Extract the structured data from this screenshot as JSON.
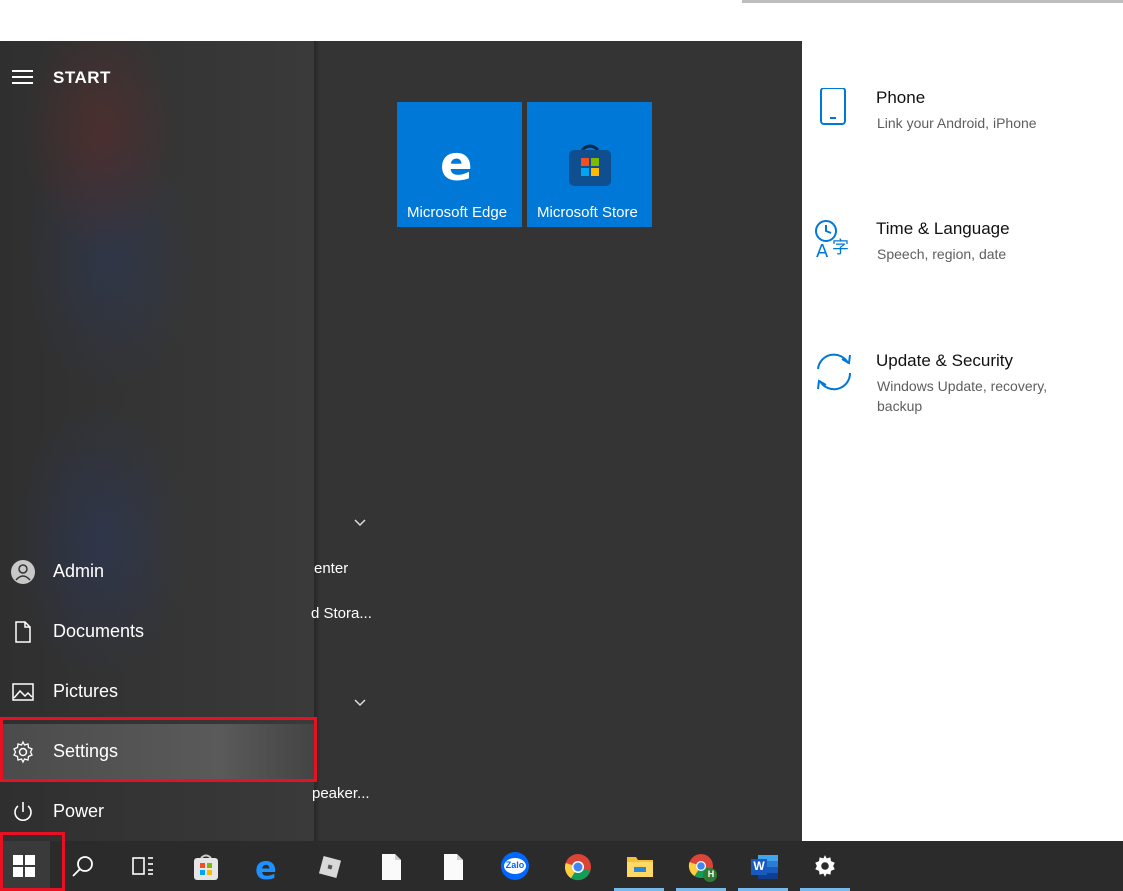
{
  "settings": {
    "items": [
      {
        "title": "Phone",
        "desc": "Link your Android, iPhone",
        "icon": "phone-icon"
      },
      {
        "title": "Time & Language",
        "desc": "Speech, region, date",
        "icon": "time-language-icon"
      },
      {
        "title": "Update & Security",
        "desc": "Windows Update, recovery, backup",
        "icon": "update-security-icon"
      }
    ]
  },
  "start_menu": {
    "title": "START",
    "nav": [
      {
        "label": "Admin",
        "icon": "user-icon"
      },
      {
        "label": "Documents",
        "icon": "document-icon"
      },
      {
        "label": "Pictures",
        "icon": "pictures-icon"
      },
      {
        "label": "Settings",
        "icon": "gear-icon"
      },
      {
        "label": "Power",
        "icon": "power-icon"
      }
    ],
    "app_fragments": [
      "enter",
      "d Stora...",
      "peaker..."
    ],
    "tiles": [
      {
        "label": "Microsoft Edge",
        "icon": "edge-icon"
      },
      {
        "label": "Microsoft Store",
        "icon": "store-icon"
      }
    ]
  },
  "colors": {
    "accent": "#0078d7",
    "highlight": "#e81123",
    "taskbar": "#2b2b2b"
  },
  "taskbar": {
    "icons": [
      "windows-start-icon",
      "search-icon",
      "task-view-icon",
      "store-icon",
      "edge-icon",
      "roblox-icon",
      "blank-file-icon",
      "blank-file-icon",
      "zalo-icon",
      "chrome-icon",
      "file-explorer-icon",
      "chrome-profile-icon",
      "word-icon",
      "settings-gear-icon"
    ],
    "zalo_label": "Zalo",
    "word_label": "W",
    "chrome_profile_badge": "H"
  }
}
